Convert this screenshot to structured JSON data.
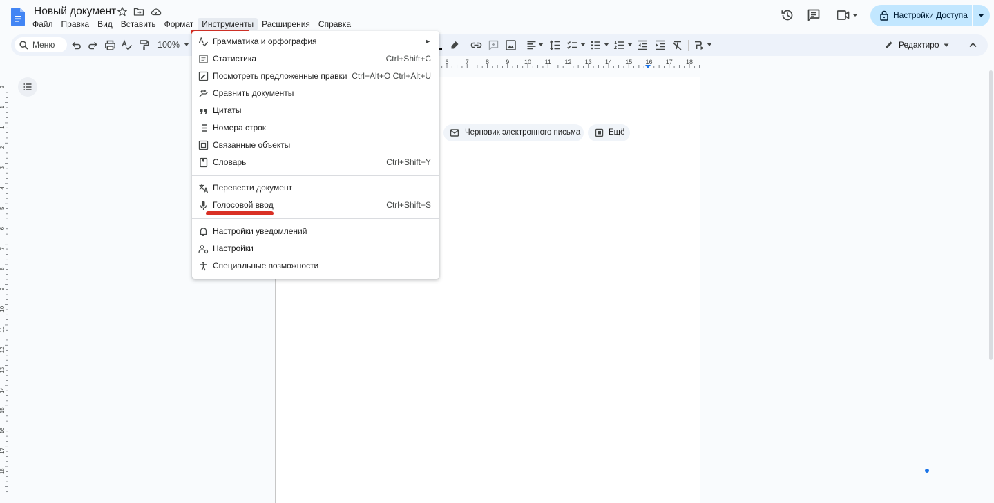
{
  "app": {
    "title": "Новый документ",
    "menu": [
      "Файл",
      "Правка",
      "Вид",
      "Вставить",
      "Формат",
      "Инструменты",
      "Расширения",
      "Справка"
    ],
    "active_menu": "Инструменты",
    "share_label": "Настройки Доступа"
  },
  "toolbar": {
    "search_label": "Меню",
    "zoom": "100%",
    "edit_mode": "Редактиро"
  },
  "ruler": {
    "h_labels": [
      "6",
      "7",
      "8",
      "9",
      "10",
      "11",
      "12",
      "13",
      "14",
      "15",
      "16",
      "17",
      "18"
    ],
    "v_labels": [
      "2",
      "1",
      "1",
      "2",
      "3",
      "4",
      "5",
      "6",
      "7",
      "8",
      "9",
      "10",
      "11",
      "12",
      "13",
      "14",
      "15",
      "16",
      "17",
      "18"
    ]
  },
  "page": {
    "chips": {
      "email_draft": "Черновик электронного письма",
      "more": "Ещё"
    }
  },
  "tools_menu": {
    "items": [
      {
        "label": "Грамматика и орфография",
        "shortcut": "",
        "icon": "spellcheck-icon",
        "submenu": true
      },
      {
        "label": "Статистика",
        "shortcut": "Ctrl+Shift+C",
        "icon": "word-count-icon"
      },
      {
        "label": "Посмотреть предложенные правки",
        "shortcut": "Ctrl+Alt+O Ctrl+Alt+U",
        "icon": "review-edits-icon"
      },
      {
        "label": "Сравнить документы",
        "shortcut": "",
        "icon": "compare-icon"
      },
      {
        "label": "Цитаты",
        "shortcut": "",
        "icon": "quote-icon"
      },
      {
        "label": "Номера строк",
        "shortcut": "",
        "icon": "line-numbers-icon"
      },
      {
        "label": "Связанные объекты",
        "shortcut": "",
        "icon": "linked-objects-icon"
      },
      {
        "label": "Словарь",
        "shortcut": "Ctrl+Shift+Y",
        "icon": "dictionary-icon"
      },
      {
        "label": "Перевести документ",
        "shortcut": "",
        "icon": "translate-icon"
      },
      {
        "label": "Голосовой ввод",
        "shortcut": "Ctrl+Shift+S",
        "icon": "microphone-icon"
      },
      {
        "label": "Настройки уведомлений",
        "shortcut": "",
        "icon": "bell-icon"
      },
      {
        "label": "Настройки",
        "shortcut": "",
        "icon": "preferences-icon"
      },
      {
        "label": "Специальные возможности",
        "shortcut": "",
        "icon": "accessibility-icon"
      }
    ],
    "submenu_arrow": "►"
  },
  "colors": {
    "accent": "#1a73e8",
    "share_bg": "#c2e7ff",
    "highlight_red": "#d93025",
    "toolbar_bg": "#edf2fa"
  }
}
